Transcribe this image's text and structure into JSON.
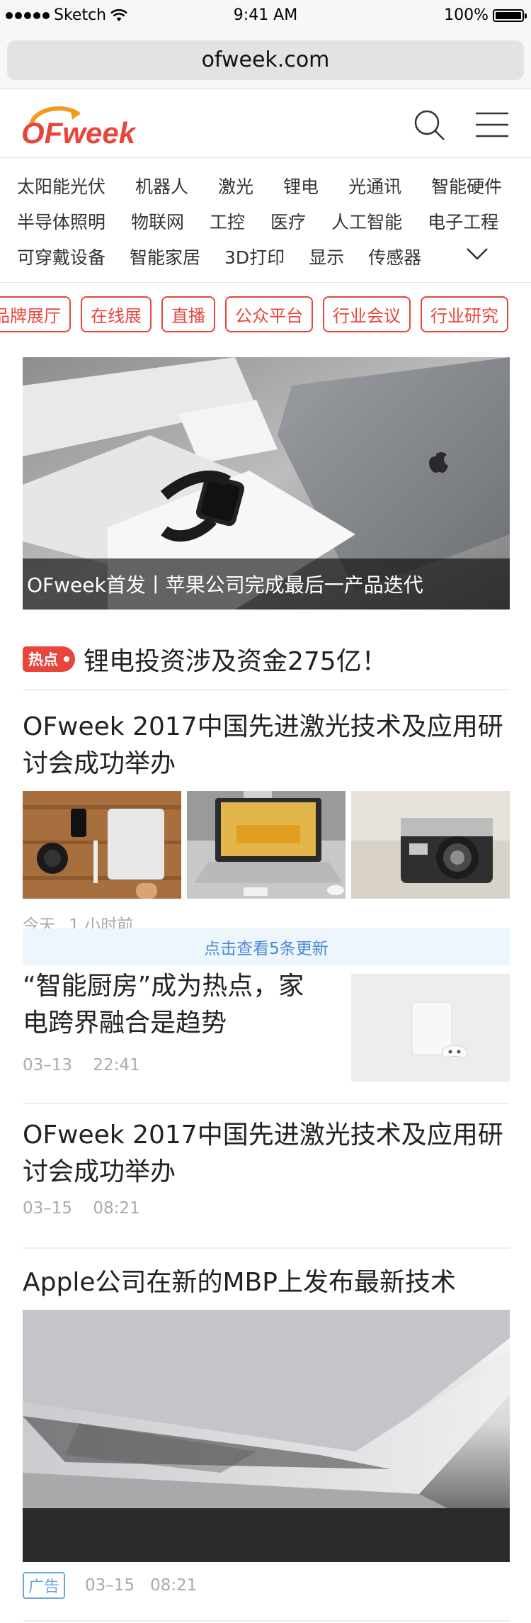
{
  "status": {
    "carrier": "Sketch",
    "time": "9:41 AM",
    "battery": "100%"
  },
  "browser": {
    "url": "ofweek.com"
  },
  "header": {
    "logo_text": "OFweek"
  },
  "categories": {
    "row1": [
      "太阳能光伏",
      "机器人",
      "激光",
      "锂电",
      "光通讯",
      "智能硬件"
    ],
    "row2": [
      "半导体照明",
      "物联网",
      "工控",
      "医疗",
      "人工智能",
      "电子工程"
    ],
    "row3": [
      "可穿戴设备",
      "智能家居",
      "3D打印",
      "显示",
      "传感器"
    ]
  },
  "tags": [
    "品牌展厅",
    "在线展",
    "直播",
    "公众平台",
    "行业会议",
    "行业研究"
  ],
  "hero": {
    "caption": "OFweek首发丨苹果公司完成最后一产品迭代"
  },
  "hot": {
    "badge": "热点",
    "text": "锂电投资涉及资金275亿！"
  },
  "articles": [
    {
      "title": "OFweek 2017中国先进激光技术及应用研讨会成功举办",
      "date": "今天",
      "time": "1 小时前"
    },
    {
      "title": "“智能厨房”成为热点，家电跨界融合是趋势",
      "date": "03–13",
      "time": "22:41"
    },
    {
      "title": "OFweek 2017中国先进激光技术及应用研讨会成功举办",
      "date": "03–15",
      "time": "08:21"
    },
    {
      "title": "Apple公司在新的MBP上发布最新技术",
      "ad": "广告",
      "date": "03–15",
      "time": "08:21"
    }
  ],
  "update_bar": {
    "text": "点击查看5条更新"
  },
  "colors": {
    "brand": "#e8463c",
    "accent_blue": "#4a8ad4",
    "update_bg": "#edf5fd"
  }
}
